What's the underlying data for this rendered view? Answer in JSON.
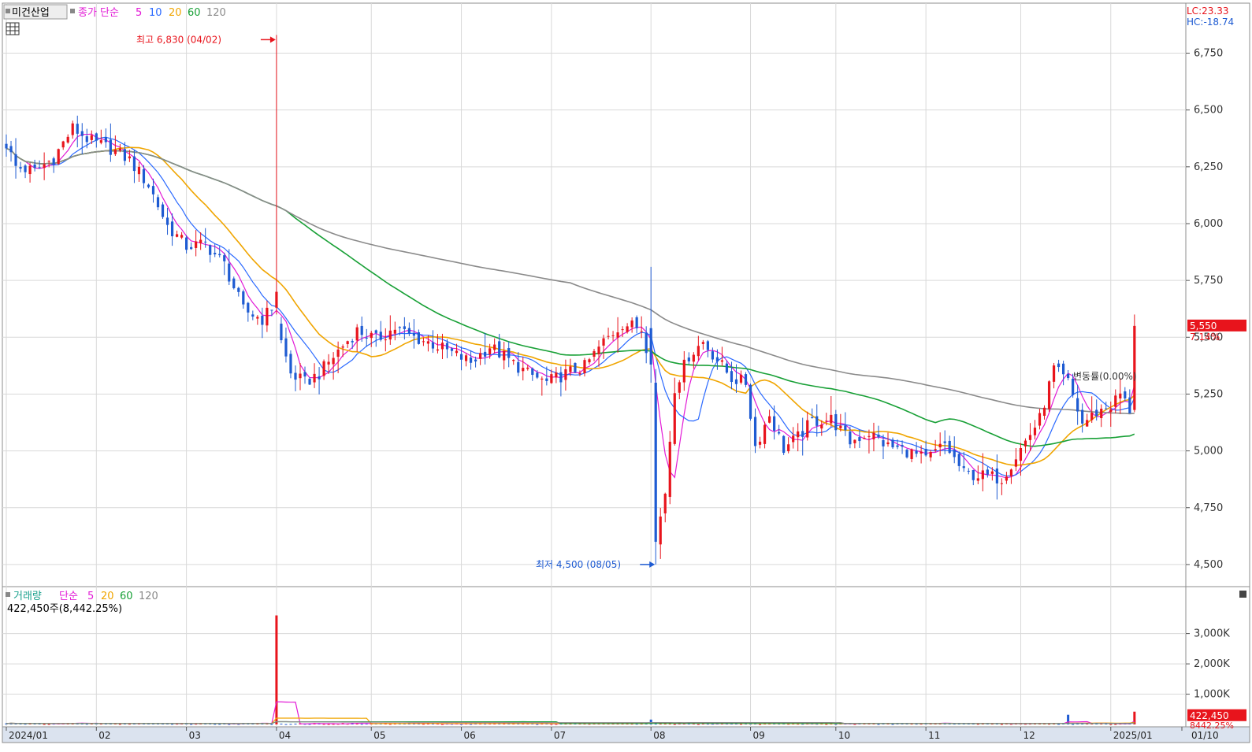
{
  "colors": {
    "up": "#e8141c",
    "down": "#1e5bd2",
    "ma5": "#e21ad6",
    "ma10": "#2a69ff",
    "ma20": "#f0a500",
    "ma60": "#18a036",
    "ma120": "#8a8a8a",
    "grid": "#d9d9d9",
    "border": "#8c8c8c",
    "axis_bg": "#dbe3ef"
  },
  "price_panel": {
    "stock_name": "미건산업",
    "legend_prefix": "종가 단순",
    "ma_periods": [
      "5",
      "10",
      "20",
      "60",
      "120"
    ],
    "lc_text": "LC:23.33",
    "hc_text": "HC:-18.74",
    "high_annotation": "최고 6,830 (04/02)",
    "low_annotation": "최저 4,500 (08/05)",
    "current_price_label": "5,550",
    "current_change_label": "7.14%",
    "volatility_label": "변동률(0.00%)"
  },
  "volume_panel": {
    "title": "거래량",
    "legend_prefix": "단순",
    "ma_periods": [
      "5",
      "20",
      "60",
      "120"
    ],
    "current_volume_text": "422,450주(8,442.25%)",
    "current_volume_label": "422,450",
    "current_ratio_label": "8442.25%"
  },
  "chart_data": [
    {
      "type": "candlestick",
      "title": "미건산업",
      "price_axis": {
        "ylim": [
          4420,
          6880
        ],
        "ticks": [
          4500,
          4750,
          5000,
          5250,
          5500,
          5750,
          6000,
          6250,
          6500,
          6750
        ],
        "tick_labels": [
          "4,500",
          "4,750",
          "5,000",
          "5,250",
          "5,500",
          "5,750",
          "6,000",
          "6,250",
          "6,500",
          "6,750"
        ],
        "grid": true
      },
      "time_axis": {
        "labels": [
          "2024/01",
          "02",
          "03",
          "04",
          "05",
          "06",
          "07",
          "08",
          "09",
          "10",
          "11",
          "12",
          "2025/01",
          "01/10"
        ],
        "label_days": [
          0,
          19,
          38,
          57,
          77,
          96,
          115,
          136,
          157,
          175,
          194,
          214,
          233,
          248
        ]
      },
      "anchors": [
        {
          "day": 0,
          "close": 6350
        },
        {
          "day": 2,
          "close": 6250
        },
        {
          "day": 6,
          "close": 6230
        },
        {
          "day": 10,
          "close": 6290
        },
        {
          "day": 14,
          "close": 6420
        },
        {
          "day": 18,
          "close": 6360
        },
        {
          "day": 22,
          "close": 6330
        },
        {
          "day": 26,
          "close": 6280
        },
        {
          "day": 30,
          "close": 6170
        },
        {
          "day": 34,
          "close": 5990
        },
        {
          "day": 38,
          "close": 5900
        },
        {
          "day": 42,
          "close": 5910
        },
        {
          "day": 46,
          "close": 5820
        },
        {
          "day": 50,
          "close": 5620
        },
        {
          "day": 54,
          "close": 5580
        },
        {
          "day": 56,
          "close": 5630
        },
        {
          "day": 58,
          "close": 5480
        },
        {
          "day": 60,
          "close": 5340
        },
        {
          "day": 63,
          "close": 5300
        },
        {
          "day": 66,
          "close": 5340
        },
        {
          "day": 70,
          "close": 5440
        },
        {
          "day": 74,
          "close": 5530
        },
        {
          "day": 78,
          "close": 5490
        },
        {
          "day": 82,
          "close": 5540
        },
        {
          "day": 86,
          "close": 5500
        },
        {
          "day": 90,
          "close": 5470
        },
        {
          "day": 94,
          "close": 5430
        },
        {
          "day": 98,
          "close": 5390
        },
        {
          "day": 102,
          "close": 5460
        },
        {
          "day": 106,
          "close": 5400
        },
        {
          "day": 110,
          "close": 5340
        },
        {
          "day": 114,
          "close": 5300
        },
        {
          "day": 118,
          "close": 5340
        },
        {
          "day": 122,
          "close": 5370
        },
        {
          "day": 126,
          "close": 5480
        },
        {
          "day": 130,
          "close": 5560
        },
        {
          "day": 134,
          "close": 5540
        },
        {
          "day": 136,
          "close": 5380
        },
        {
          "day": 137,
          "close": 4600
        },
        {
          "day": 139,
          "close": 4820
        },
        {
          "day": 141,
          "close": 5280
        },
        {
          "day": 144,
          "close": 5420
        },
        {
          "day": 147,
          "close": 5480
        },
        {
          "day": 150,
          "close": 5400
        },
        {
          "day": 153,
          "close": 5320
        },
        {
          "day": 156,
          "close": 5300
        },
        {
          "day": 158,
          "close": 5020
        },
        {
          "day": 161,
          "close": 5160
        },
        {
          "day": 164,
          "close": 5010
        },
        {
          "day": 167,
          "close": 5060
        },
        {
          "day": 170,
          "close": 5130
        },
        {
          "day": 174,
          "close": 5140
        },
        {
          "day": 178,
          "close": 5040
        },
        {
          "day": 182,
          "close": 5080
        },
        {
          "day": 186,
          "close": 5020
        },
        {
          "day": 190,
          "close": 5000
        },
        {
          "day": 194,
          "close": 4960
        },
        {
          "day": 198,
          "close": 5030
        },
        {
          "day": 202,
          "close": 4900
        },
        {
          "day": 206,
          "close": 4890
        },
        {
          "day": 210,
          "close": 4880
        },
        {
          "day": 214,
          "close": 5010
        },
        {
          "day": 218,
          "close": 5140
        },
        {
          "day": 221,
          "close": 5360
        },
        {
          "day": 224,
          "close": 5300
        },
        {
          "day": 227,
          "close": 5120
        },
        {
          "day": 230,
          "close": 5170
        },
        {
          "day": 233,
          "close": 5200
        },
        {
          "day": 235,
          "close": 5250
        },
        {
          "day": 237,
          "close": 5180
        },
        {
          "day": 238,
          "close": 5550
        }
      ],
      "highlight_candles": [
        {
          "day": 57,
          "open": 5630,
          "high": 6830,
          "low": 5600,
          "close": 5700
        },
        {
          "day": 136,
          "open": 5540,
          "high": 5810,
          "low": 5300,
          "close": 5380
        },
        {
          "day": 137,
          "open": 5300,
          "high": 5360,
          "low": 4500,
          "close": 4600
        },
        {
          "day": 238,
          "open": 5180,
          "high": 5600,
          "low": 5170,
          "close": 5550
        }
      ],
      "moving_averages": [
        {
          "period": 5,
          "style": "ma5"
        },
        {
          "period": 10,
          "style": "ma10"
        },
        {
          "period": 20,
          "style": "ma20"
        },
        {
          "period": 60,
          "style": "ma60"
        },
        {
          "period": 120,
          "style": "ma120"
        }
      ],
      "volume_axis": {
        "ylim": [
          0,
          3900
        ],
        "ticks": [
          1000,
          2000,
          3000
        ],
        "tick_labels": [
          "1,000K",
          "2,000K",
          "3,000K"
        ]
      },
      "volume_spikes": [
        {
          "day": 57,
          "volume_k": 3600
        },
        {
          "day": 136,
          "volume_k": 160
        },
        {
          "day": 224,
          "volume_k": 320
        },
        {
          "day": 238,
          "volume_k": 422.45
        }
      ]
    }
  ]
}
